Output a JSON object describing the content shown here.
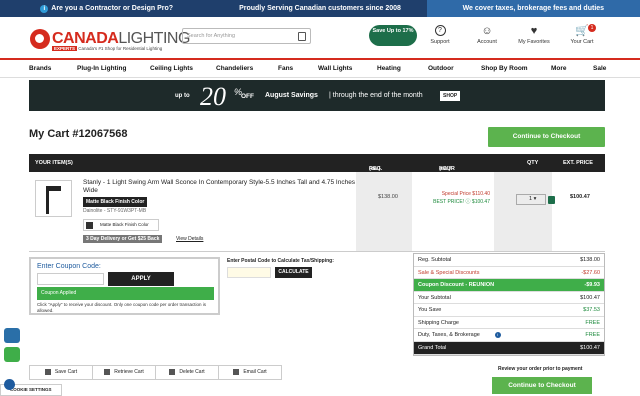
{
  "topbar": {
    "left": "Are you a Contractor or Design Pro?",
    "center": "Proudly Serving Canadian customers since 2008",
    "right": "We cover taxes, brokerage fees and duties"
  },
  "header": {
    "logo_part1": "CANADA",
    "logo_part2": "LIGHTING",
    "logo_tag_red": "EXPERTS",
    "logo_tag": "Canada's #1 Shop for Residential Lighting",
    "search_placeholder": "Search for Anything",
    "save_button": "Save Up to 17%",
    "support": "Support",
    "account": "Account",
    "favorites": "My Favorites",
    "cart": "Your Cart",
    "cart_count": "1"
  },
  "nav": [
    "Brands",
    "Plug-In Lighting",
    "Ceiling Lights",
    "Chandeliers",
    "Fans",
    "Wall Lights",
    "Heating",
    "Outdoor",
    "Shop By Room",
    "More",
    "Sale"
  ],
  "banner": {
    "upto": "up to",
    "big": "20",
    "pct": "%",
    "off": "OFF",
    "headline": "August Savings",
    "sub": "| through the end of the month",
    "shop": "SHOP"
  },
  "cart": {
    "title": "My Cart #12067568",
    "checkout": "Continue to Checkout",
    "columns": {
      "items": "YOUR ITEM(S)",
      "reg": "REG. PRICE",
      "reg_suffix": "(ea.)",
      "your": "YOUR PRICE",
      "your_suffix": "(ea.)",
      "qty": "QTY",
      "ext": "EXT. PRICE"
    },
    "item": {
      "title": "Stanly - 1 Light Swing Arm Wall Sconce In Contemporary Style-5.5 Inches Tall and 4.75 Inches Wide",
      "finish_badge": "Matte Black Finish Color",
      "sku": "Dainolite - STY-91W3PT-MB",
      "swatch": "Matte Black Finish Color",
      "shipping": "3 Day Delivery or Get $25 Back",
      "view_details": "View Details",
      "reg_price": "$138.00",
      "special_price": "Special Price $110.40",
      "best_price": "BEST PRICE! ⓘ $100.47",
      "qty": "1",
      "ext_price": "$100.47"
    }
  },
  "coupon": {
    "label": "Enter Coupon Code:",
    "apply": "APPLY",
    "applied": "Coupon Applied",
    "note": "Click \"Apply\" to receive your discount. Only one coupon code per order transaction is allowed."
  },
  "postal": {
    "label": "Enter Postal Code to Calculate Tax/Shipping:",
    "button": "CALCULATE"
  },
  "summary": [
    {
      "label": "Reg. Subtotal",
      "value": "$138.00"
    },
    {
      "label": "Sale & Special Discounts",
      "value": "-$27.60"
    },
    {
      "label": "Coupon Discount - REUNION",
      "value": "-$9.93"
    },
    {
      "label": "Your Subtotal",
      "value": "$100.47"
    },
    {
      "label": "You Save",
      "value": "$37.53"
    },
    {
      "label": "Shipping Charge",
      "value": "FREE"
    },
    {
      "label": "Duty, Taxes, & Brokerage",
      "value": "FREE"
    },
    {
      "label": "Grand Total",
      "value": "$100.47"
    }
  ],
  "actions": {
    "save": "Save Cart",
    "retrieve": "Retrieve Cart",
    "delete": "Delete Cart",
    "email": "Email Cart"
  },
  "review": "Review your order prior to payment",
  "cookie": "COOKIE SETTINGS",
  "colors": {
    "brand_red": "#d52b1e",
    "dark_navy": "#1f3f6c",
    "checkout_green": "#5cb34e"
  }
}
